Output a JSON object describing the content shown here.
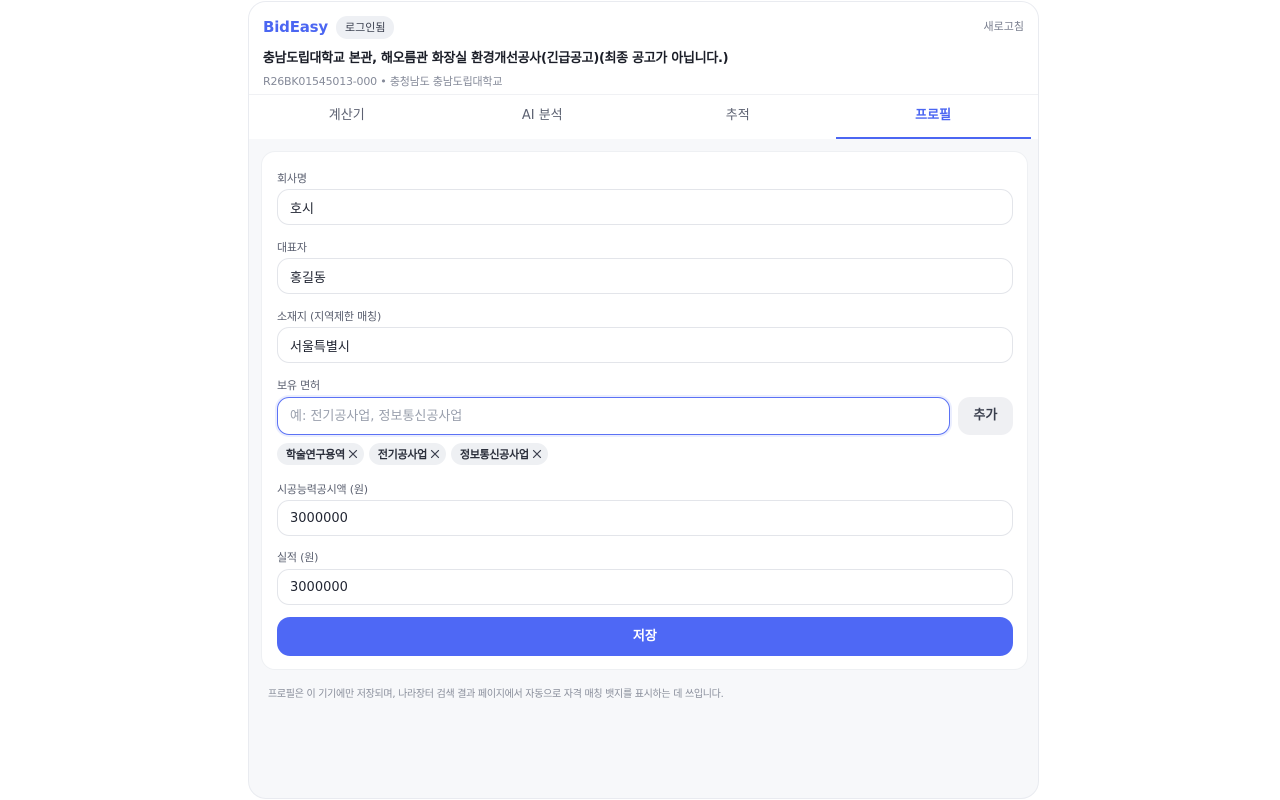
{
  "header": {
    "brand": "BidEasy",
    "login_label": "로그인됨",
    "refresh_label": "새로고침",
    "notice_title": "충남도립대학교 본관, 해오름관 화장실 환경개선공사(긴급공고)(최종 공고가 아닙니다.)",
    "notice_meta": "R26BK01545013-000 • 충청남도 충남도립대학교"
  },
  "tabs": [
    {
      "label": "계산기"
    },
    {
      "label": "AI 분석"
    },
    {
      "label": "추적"
    },
    {
      "label": "프로필"
    }
  ],
  "active_tab": "프로필",
  "form": {
    "company_label": "회사명",
    "company_value": "호시",
    "ceo_label": "대표자",
    "ceo_value": "홍길동",
    "location_label": "소재지 (지역제한 매칭)",
    "location_value": "서울특별시",
    "license_label": "보유 면허",
    "license_placeholder": "예: 전기공사업, 정보통신공사업",
    "add_label": "추가",
    "licenses": [
      {
        "label": "학술연구용역"
      },
      {
        "label": "전기공사업"
      },
      {
        "label": "정보통신공사업"
      }
    ],
    "capacity_label": "시공능력공시액 (원)",
    "capacity_value": "3000000",
    "performance_label": "실적 (원)",
    "performance_value": "3000000",
    "save_label": "저장"
  },
  "footnote": "프로필은 이 기기에만 저장되며, 나라장터 검색 결과 페이지에서 자동으로 자격 매칭 뱃지를 표시하는 데 쓰입니다.",
  "colors": {
    "accent": "#4e68f5",
    "brand": "#4b66f2"
  }
}
